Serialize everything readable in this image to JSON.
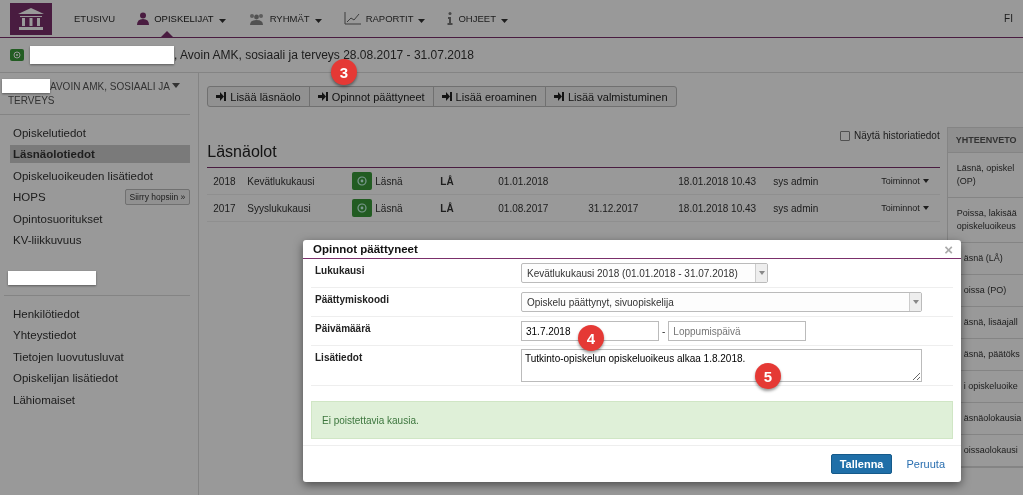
{
  "navbar": {
    "items": [
      {
        "label": "ETUSIVU",
        "selected": false
      },
      {
        "label": "OPISKELIJAT",
        "selected": true
      },
      {
        "label": "RYHMÄT",
        "selected": false
      },
      {
        "label": "RAPORTIT",
        "selected": false
      },
      {
        "label": "OHJEET",
        "selected": false
      }
    ],
    "language": "FI"
  },
  "header": {
    "text": ", Avoin AMK, sosiaali ja terveys 28.08.2017 - 31.07.2018"
  },
  "sidebar": {
    "heading": [
      "AVOIN AMK, SOSIAALI JA",
      "TERVEYS"
    ],
    "items": [
      {
        "label": "Opiskelutiedot",
        "selected": false
      },
      {
        "label": "Läsnäolotiedot",
        "selected": true
      },
      {
        "label": "Opiskeluoikeuden lisätiedot",
        "selected": false
      },
      {
        "label": "HOPS",
        "selected": false,
        "button": "Siirry hopsiin »"
      },
      {
        "label": "Opintosuoritukset",
        "selected": false
      },
      {
        "label": "KV-liikkuvuus",
        "selected": false
      }
    ],
    "items_2": [
      {
        "label": "Henkilötiedot",
        "selected": false
      },
      {
        "label": "Yhteystiedot",
        "selected": false
      },
      {
        "label": "Tietojen luovutusluvat",
        "selected": false
      },
      {
        "label": "Opiskelijan lisätiedot",
        "selected": false
      },
      {
        "label": "Lähiomaiset",
        "selected": false
      }
    ]
  },
  "toolbar": [
    "Lisää läsnäolo",
    "Opinnot päättyneet",
    "Lisää eroaminen",
    "Lisää valmistuminen"
  ],
  "history_checkbox": {
    "label": "Näytä historiatiedot",
    "checked": false
  },
  "section_title": "Läsnäolot",
  "rows": [
    {
      "year": "2018",
      "term": "Kevätlukukausi",
      "status": "Läsnä",
      "code": "LÅ",
      "start": "01.01.2018",
      "modified": "18.01.2018 10.43",
      "user": "sys admin",
      "actions": "Toiminnot"
    },
    {
      "year": "2017",
      "term": "Syyslukukausi",
      "status": "Läsnä",
      "code": "LÅ",
      "start": "01.08.2017",
      "end": "31.12.2017",
      "modified": "18.01.2018 10.43",
      "user": "sys admin",
      "actions": "Toiminnot"
    }
  ],
  "summary": {
    "title": "YHTEENVETO",
    "items": [
      {
        "lines": [
          "Läsnä, opiskel",
          "(OP)"
        ]
      },
      {
        "lines": [
          "Poissa, lakisää",
          "opiskeluoikeus"
        ]
      },
      {
        "lines": [
          "äsnä (LÅ)"
        ]
      },
      {
        "lines": [
          "oissa (PO)"
        ]
      },
      {
        "lines": [
          "äsnä, lisäajall"
        ]
      },
      {
        "lines": [
          "äsnä, päätöks"
        ]
      },
      {
        "lines": [
          "i opiskeluoike"
        ]
      },
      {
        "lines": [
          "äsnäolokausia"
        ]
      },
      {
        "lines": [
          "oissaolokausi"
        ]
      }
    ]
  },
  "dialog": {
    "title": "Opinnot päättyneet",
    "close": "×",
    "fields": [
      {
        "kind": "select",
        "label": "Lukukausi",
        "value": "Kevätlukukausi 2018 (01.01.2018 - 31.07.2018)"
      },
      {
        "kind": "select",
        "label": "Päättymiskoodi",
        "value": "Opiskelu päättynyt, sivuopiskelija"
      },
      {
        "kind": "date-range",
        "label": "Päivämäärä",
        "value": "31.7.2018",
        "separator": "-",
        "placeholder": "Loppumispäivä"
      },
      {
        "kind": "textarea",
        "label": "Lisätiedot",
        "value": "Tutkinto-opiskelun opiskeluoikeus alkaa 1.8.2018."
      }
    ],
    "alert": "Ei poistettavia kausia.",
    "save": "Tallenna",
    "cancel": "Peruuta"
  },
  "markers": [
    "3",
    "4",
    "5"
  ]
}
